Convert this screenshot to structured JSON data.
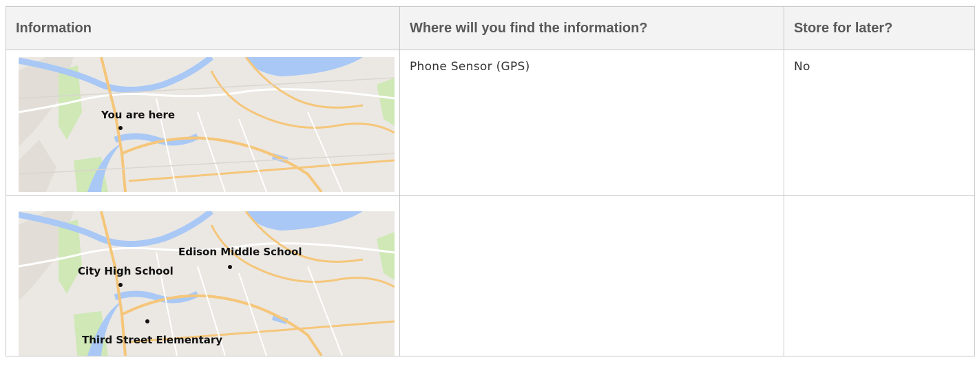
{
  "table": {
    "headers": [
      "Information",
      "Where will you find the information?",
      "Store for later?"
    ],
    "rows": [
      {
        "map_labels": [
          "You are here"
        ],
        "where": "Phone Sensor (GPS)",
        "store": "No"
      },
      {
        "map_labels": [
          "Edison Middle School",
          "City High School",
          "Third Street Elementary"
        ],
        "where": "",
        "store": ""
      }
    ]
  },
  "colors": {
    "water": "#a9c8f5",
    "land": "#ebe8e3",
    "park": "#cfe8b6",
    "road_major": "#f5c67a",
    "road_minor": "#ffffff",
    "border": "#c8c8c8",
    "header_bg": "#f3f3f3"
  }
}
